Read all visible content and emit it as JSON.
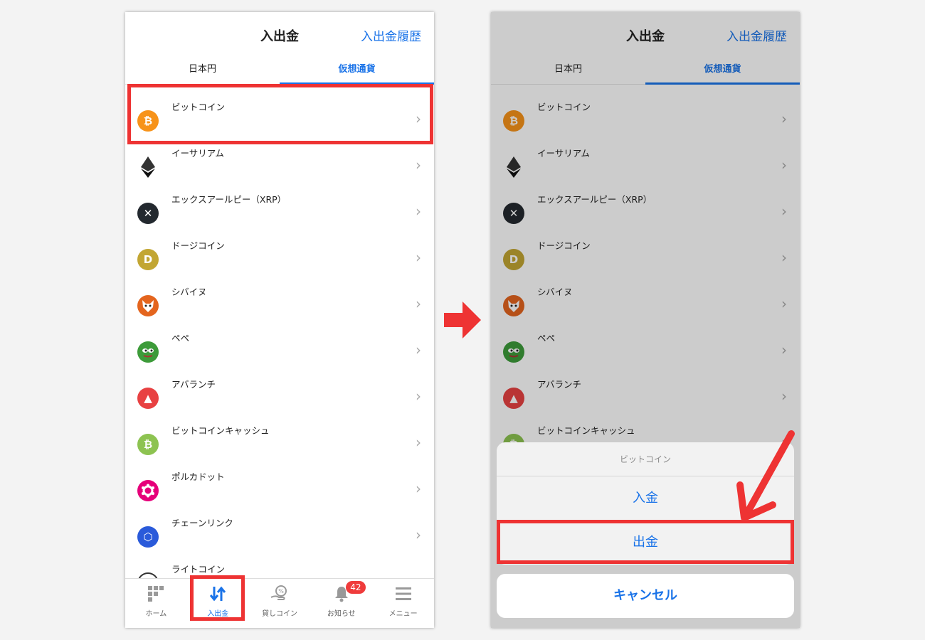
{
  "screen": {
    "title": "入出金",
    "history_link": "入出金履歴",
    "tabs": [
      "日本円",
      "仮想通貨"
    ]
  },
  "coins": [
    {
      "name": "ビットコイン",
      "glyph": "₿",
      "color": "#f7931a",
      "icon": "bitcoin-icon"
    },
    {
      "name": "イーサリアム",
      "glyph": "",
      "color": "#ffffff",
      "icon": "ethereum-icon"
    },
    {
      "name": "エックスアールピー（XRP）",
      "glyph": "✕",
      "color": "#23292f",
      "icon": "xrp-icon"
    },
    {
      "name": "ドージコイン",
      "glyph": "D",
      "color": "#c2a633",
      "icon": "dogecoin-icon"
    },
    {
      "name": "シバイヌ",
      "glyph": "",
      "color": "#e4651e",
      "icon": "shiba-inu-icon"
    },
    {
      "name": "ペペ",
      "glyph": "",
      "color": "#3d9b3a",
      "icon": "pepe-icon"
    },
    {
      "name": "アバランチ",
      "glyph": "▲",
      "color": "#e84142",
      "icon": "avalanche-icon"
    },
    {
      "name": "ビットコインキャッシュ",
      "glyph": "₿",
      "color": "#8dc351",
      "icon": "bitcoin-cash-icon"
    },
    {
      "name": "ポルカドット",
      "glyph": "●",
      "color": "#e6007a",
      "icon": "polkadot-icon"
    },
    {
      "name": "チェーンリンク",
      "glyph": "⬡",
      "color": "#2a5ada",
      "icon": "chainlink-icon"
    },
    {
      "name": "ライトコイン",
      "glyph": "Ł",
      "color": "#345d9d",
      "icon": "litecoin-icon"
    }
  ],
  "tabbar": [
    {
      "label": "ホーム",
      "icon": "home-grid-icon"
    },
    {
      "label": "入出金",
      "icon": "transfer-arrows-icon"
    },
    {
      "label": "貸しコイン",
      "icon": "lending-hand-icon"
    },
    {
      "label": "お知らせ",
      "icon": "bell-icon"
    },
    {
      "label": "メニュー",
      "icon": "menu-lines-icon"
    }
  ],
  "notification_badge": "42",
  "action_sheet": {
    "title": "ビットコイン",
    "deposit": "入金",
    "withdraw": "出金",
    "cancel": "キャンセル"
  },
  "colors": {
    "accent": "#1a73e8",
    "highlight": "#ee3333",
    "badge": "#ef3b3b"
  }
}
